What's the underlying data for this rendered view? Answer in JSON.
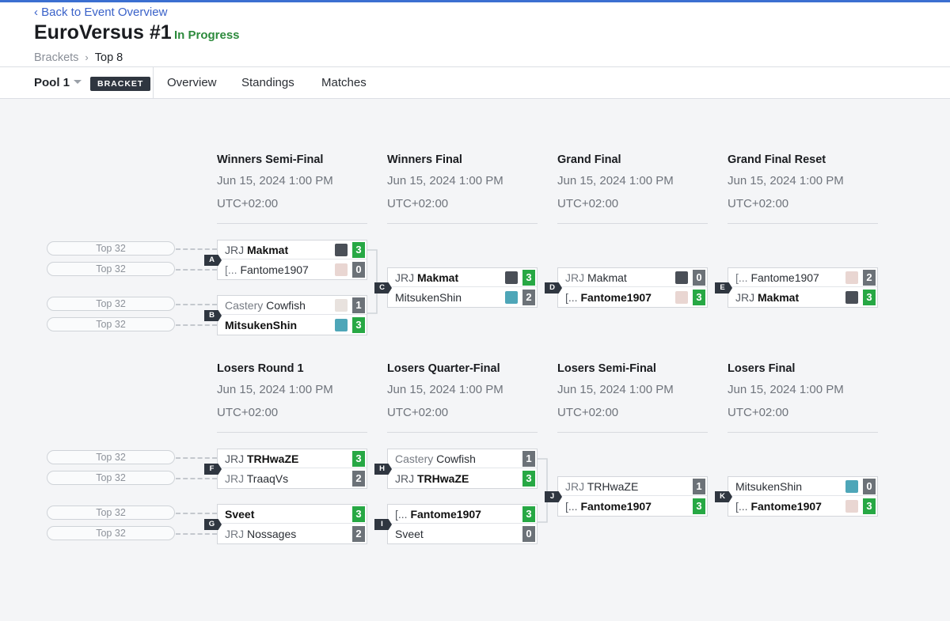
{
  "header": {
    "back_link": "Back to Event Overview",
    "title": "EuroVersus #1",
    "status": "In Progress",
    "breadcrumb": [
      "Brackets",
      "Top 8"
    ]
  },
  "tabs": {
    "pool": "Pool 1",
    "bracket_tag": "BRACKET",
    "items": [
      "Overview",
      "Standings",
      "Matches"
    ]
  },
  "rounds": [
    {
      "name": "Winners Semi-Final",
      "date": "Jun 15, 2024 1:00 PM",
      "tz": "UTC+02:00"
    },
    {
      "name": "Winners Final",
      "date": "Jun 15, 2024 1:00 PM",
      "tz": "UTC+02:00"
    },
    {
      "name": "Grand Final",
      "date": "Jun 15, 2024 1:00 PM",
      "tz": "UTC+02:00"
    },
    {
      "name": "Grand Final Reset",
      "date": "Jun 15, 2024 1:00 PM",
      "tz": "UTC+02:00"
    },
    {
      "name": "Losers Round 1",
      "date": "Jun 15, 2024 1:00 PM",
      "tz": "UTC+02:00"
    },
    {
      "name": "Losers Quarter-Final",
      "date": "Jun 15, 2024 1:00 PM",
      "tz": "UTC+02:00"
    },
    {
      "name": "Losers Semi-Final",
      "date": "Jun 15, 2024 1:00 PM",
      "tz": "UTC+02:00"
    },
    {
      "name": "Losers Final",
      "date": "Jun 15, 2024 1:00 PM",
      "tz": "UTC+02:00"
    }
  ],
  "seed_label": "Top 32",
  "matches": [
    {
      "id": "A",
      "p1": {
        "prefix": "JRJ ",
        "name": "Makmat",
        "score": "3",
        "win": true
      },
      "p2": {
        "prefix": "[... ",
        "name": "Fantome1907",
        "score": "0",
        "win": false
      }
    },
    {
      "id": "B",
      "p1": {
        "prefix": "Castery ",
        "name": "Cowfish",
        "score": "1",
        "win": false
      },
      "p2": {
        "prefix": "",
        "name": "MitsukenShin",
        "score": "3",
        "win": true
      }
    },
    {
      "id": "C",
      "p1": {
        "prefix": "JRJ ",
        "name": "Makmat",
        "score": "3",
        "win": true
      },
      "p2": {
        "prefix": "",
        "name": "MitsukenShin",
        "score": "2",
        "win": false
      }
    },
    {
      "id": "D",
      "p1": {
        "prefix": "JRJ ",
        "name": "Makmat",
        "score": "0",
        "win": false
      },
      "p2": {
        "prefix": "[... ",
        "name": "Fantome1907",
        "score": "3",
        "win": true
      }
    },
    {
      "id": "E",
      "p1": {
        "prefix": "[... ",
        "name": "Fantome1907",
        "score": "2",
        "win": false
      },
      "p2": {
        "prefix": "JRJ ",
        "name": "Makmat",
        "score": "3",
        "win": true
      }
    },
    {
      "id": "F",
      "p1": {
        "prefix": "JRJ ",
        "name": "TRHwaZE",
        "score": "3",
        "win": true
      },
      "p2": {
        "prefix": "JRJ ",
        "name": "TraaqVs",
        "score": "2",
        "win": false
      }
    },
    {
      "id": "G",
      "p1": {
        "prefix": "",
        "name": "Sveet",
        "score": "3",
        "win": true
      },
      "p2": {
        "prefix": "JRJ ",
        "name": "Nossages",
        "score": "2",
        "win": false
      }
    },
    {
      "id": "H",
      "p1": {
        "prefix": "Castery ",
        "name": "Cowfish",
        "score": "1",
        "win": false
      },
      "p2": {
        "prefix": "JRJ ",
        "name": "TRHwaZE",
        "score": "3",
        "win": true
      }
    },
    {
      "id": "I",
      "p1": {
        "prefix": "[... ",
        "name": "Fantome1907",
        "score": "3",
        "win": true
      },
      "p2": {
        "prefix": "",
        "name": "Sveet",
        "score": "0",
        "win": false
      }
    },
    {
      "id": "J",
      "p1": {
        "prefix": "JRJ ",
        "name": "TRHwaZE",
        "score": "1",
        "win": false
      },
      "p2": {
        "prefix": "[... ",
        "name": "Fantome1907",
        "score": "3",
        "win": true
      }
    },
    {
      "id": "K",
      "p1": {
        "prefix": "",
        "name": "MitsukenShin",
        "score": "0",
        "win": false
      },
      "p2": {
        "prefix": "[... ",
        "name": "Fantome1907",
        "score": "3",
        "win": true
      }
    }
  ],
  "colors": {
    "accent": "#3b6fd1",
    "status": "#2c8a3c",
    "win_score": "#27a844",
    "lose_score": "#6c7278"
  }
}
